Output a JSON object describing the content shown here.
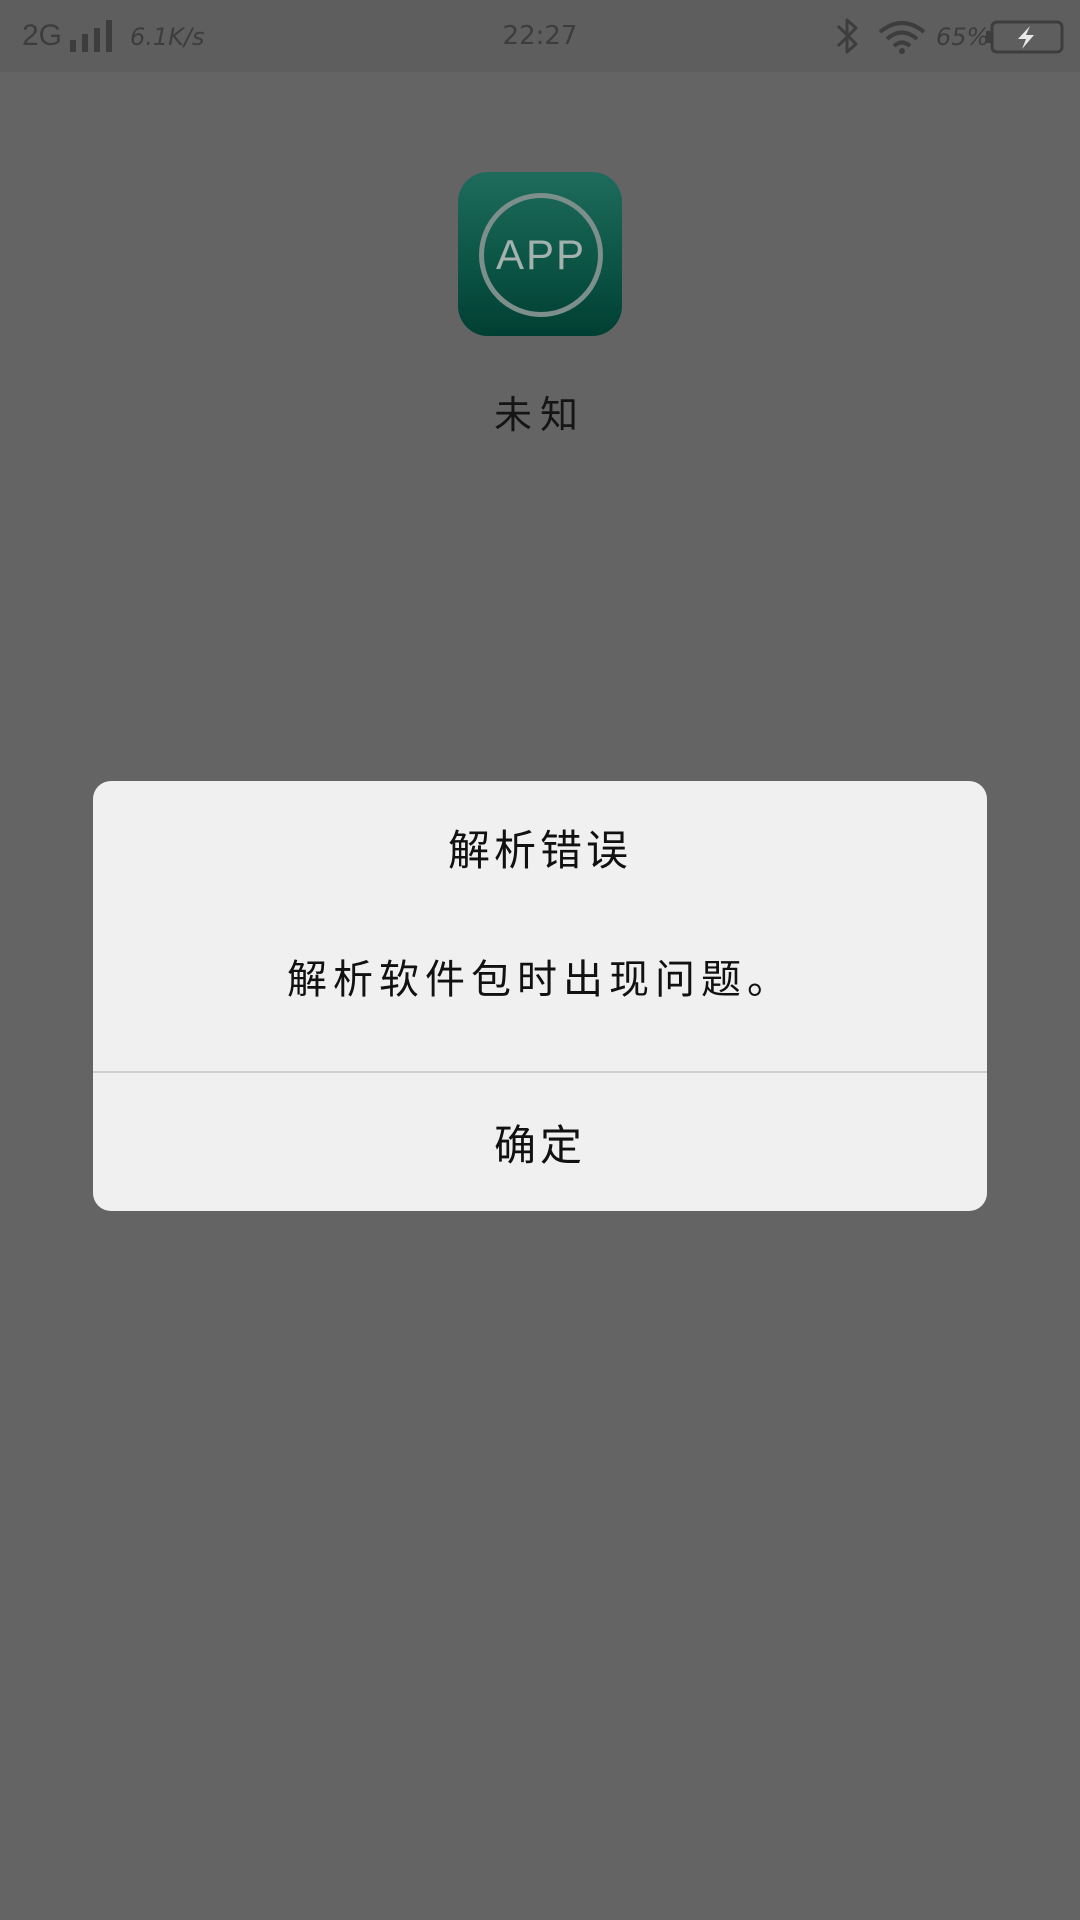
{
  "status_bar": {
    "network": "2G",
    "speed": "6.1K/s",
    "time": "22:27",
    "battery_percent": "65%",
    "icons": [
      "signal-icon",
      "bluetooth-icon",
      "wifi-icon",
      "battery-charging-icon"
    ]
  },
  "app": {
    "icon_text": "APP",
    "name": "未知"
  },
  "dialog": {
    "title": "解析错误",
    "message": "解析软件包时出现问题。",
    "ok_label": "确定"
  },
  "colors": {
    "background": "#646464",
    "status_bar": "#5e5e5e",
    "dialog": "#f0f0f0",
    "app_icon": "#0c5546"
  }
}
